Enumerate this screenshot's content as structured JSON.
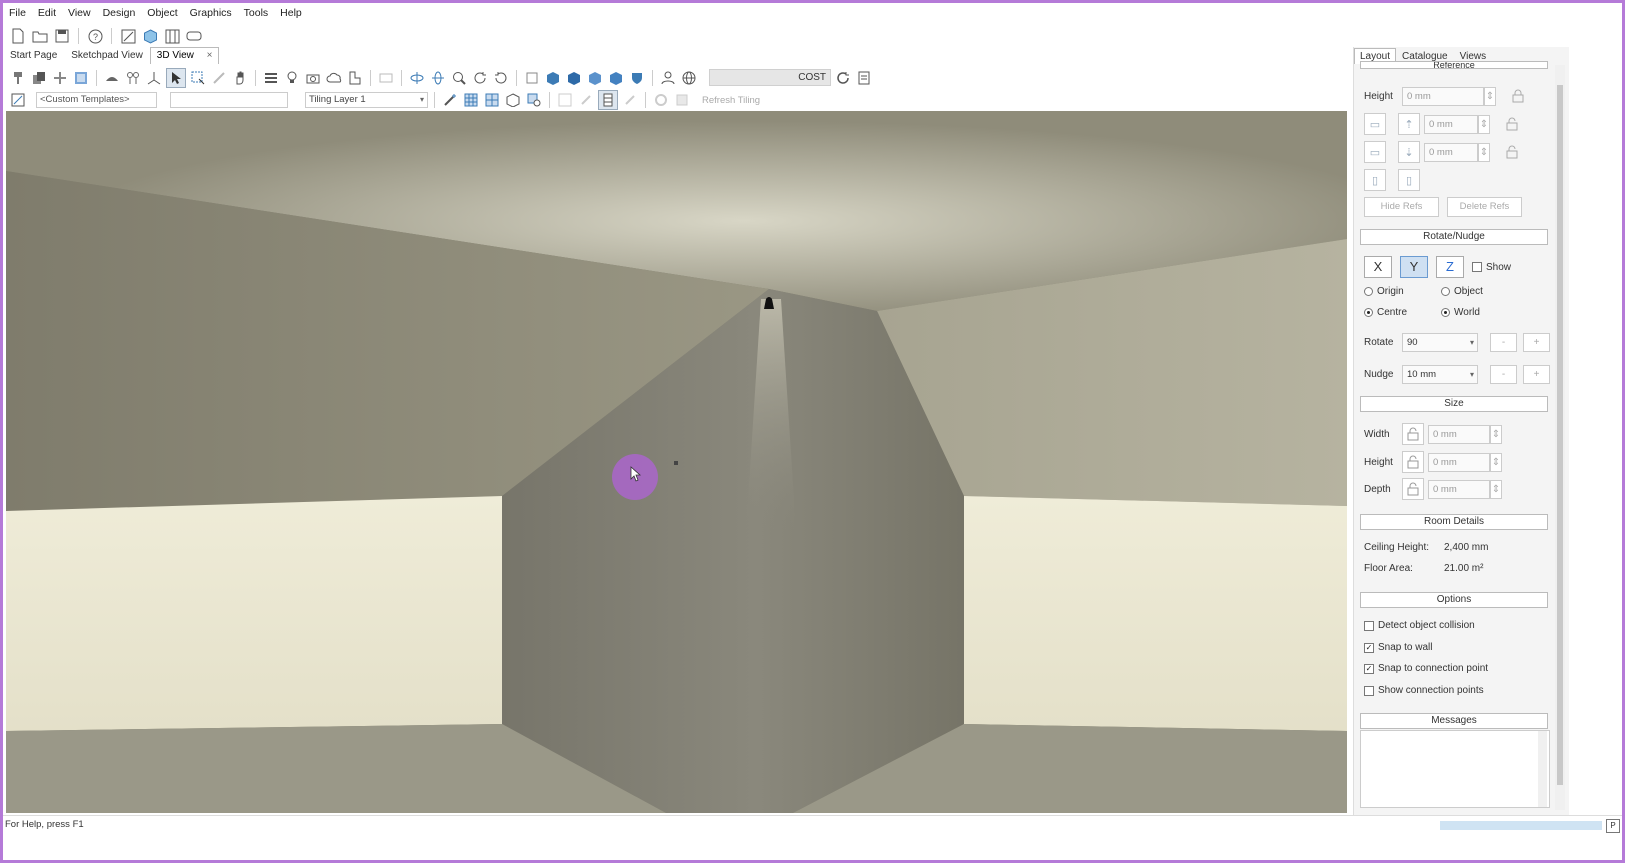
{
  "menu": [
    "File",
    "Edit",
    "View",
    "Design",
    "Object",
    "Graphics",
    "Tools",
    "Help"
  ],
  "tabs": {
    "start": "Start Page",
    "sketchpad": "Sketchpad View",
    "view3d": "3D View",
    "close": "×"
  },
  "toolbar3d": {
    "cost_label": "COST",
    "template_placeholder": "<Custom Templates>",
    "tiling_layer": "Tiling Layer 1",
    "refresh_tiling": "Refresh Tiling"
  },
  "sidebar": {
    "tabs": [
      "Layout",
      "Catalogue",
      "Views"
    ],
    "reference": {
      "title": "Reference",
      "height_label": "Height",
      "height_value": "0 mm",
      "offset1_value": "0 mm",
      "offset2_value": "0 mm",
      "hide_refs": "Hide Refs",
      "delete_refs": "Delete Refs"
    },
    "rotate_nudge": {
      "title": "Rotate/Nudge",
      "x": "X",
      "y": "Y",
      "z": "Z",
      "show": "Show",
      "origin": "Origin",
      "object": "Object",
      "centre": "Centre",
      "world": "World",
      "rotate_label": "Rotate",
      "rotate_value": "90",
      "nudge_label": "Nudge",
      "nudge_value": "10 mm",
      "minus": "-",
      "plus": "+"
    },
    "size": {
      "title": "Size",
      "width_label": "Width",
      "width_value": "0 mm",
      "height_label": "Height",
      "height_value": "0 mm",
      "depth_label": "Depth",
      "depth_value": "0 mm"
    },
    "room_details": {
      "title": "Room Details",
      "ceiling_label": "Ceiling Height:",
      "ceiling_value": "2,400 mm",
      "floor_label": "Floor Area:",
      "floor_value": "21.00 m²"
    },
    "options": {
      "title": "Options",
      "detect_collision": "Detect object collision",
      "snap_wall": "Snap to wall",
      "snap_connection": "Snap to connection point",
      "show_connection": "Show connection points",
      "checks": [
        false,
        true,
        true,
        false
      ]
    },
    "messages": {
      "title": "Messages"
    }
  },
  "status": {
    "help_text": "For Help, press F1"
  },
  "colors": {
    "frame_border": "#b57ad8",
    "cursor_halo": "#a767c7",
    "selected_axis": "#cfe0f2",
    "z_axis": "#2a6bd1"
  }
}
